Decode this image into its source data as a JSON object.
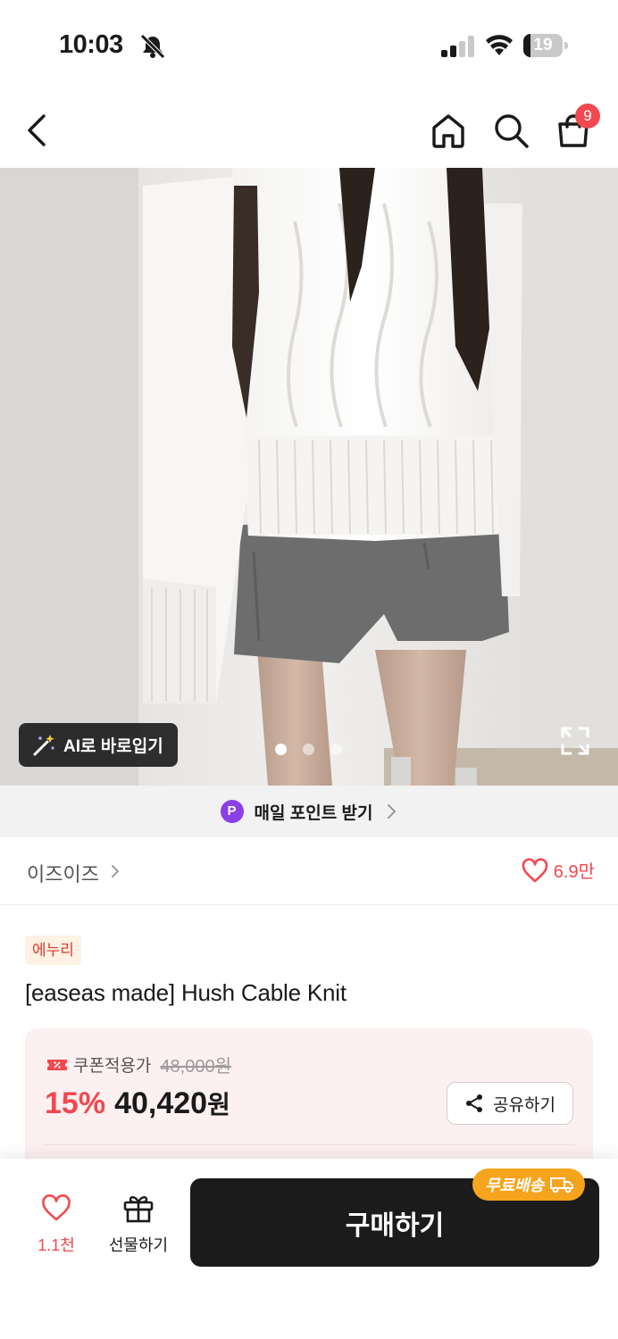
{
  "status_bar": {
    "time": "10:03",
    "battery": "19",
    "battery_level": 0.19
  },
  "header": {
    "cart_count": "9"
  },
  "hero": {
    "ai_button_label": "AI로 바로입기",
    "page_count": 3,
    "active_page": 1
  },
  "points_banner": {
    "badge": "P",
    "label": "매일 포인트 받기"
  },
  "brand": {
    "name": "이즈이즈",
    "like_count": "6.9만"
  },
  "product": {
    "tag": "에누리",
    "title": "[easeas made] Hush Cable Knit",
    "coupon_label": "쿠폰적용가",
    "original_price": "48,000원",
    "discount": "15%",
    "sale_price": "40,420",
    "currency": "원",
    "share_label": "공유하기"
  },
  "bottom_bar": {
    "wish_count": "1.1천",
    "gift_label": "선물하기",
    "buy_label": "구매하기",
    "free_shipping": "무료배송"
  },
  "colors": {
    "accent": "#f2484f",
    "points_purple": "#8b3fe6",
    "free_ship_orange": "#f7a41d",
    "buy_dark": "#1b1b1b"
  },
  "icons": [
    "bell-slash-icon",
    "signal-icon",
    "wifi-icon",
    "battery-icon",
    "back-icon",
    "home-icon",
    "search-icon",
    "cart-icon",
    "magic-wand-icon",
    "expand-icon",
    "chevron-right-icon",
    "heart-icon",
    "coupon-icon",
    "share-icon",
    "gift-icon",
    "truck-icon"
  ]
}
